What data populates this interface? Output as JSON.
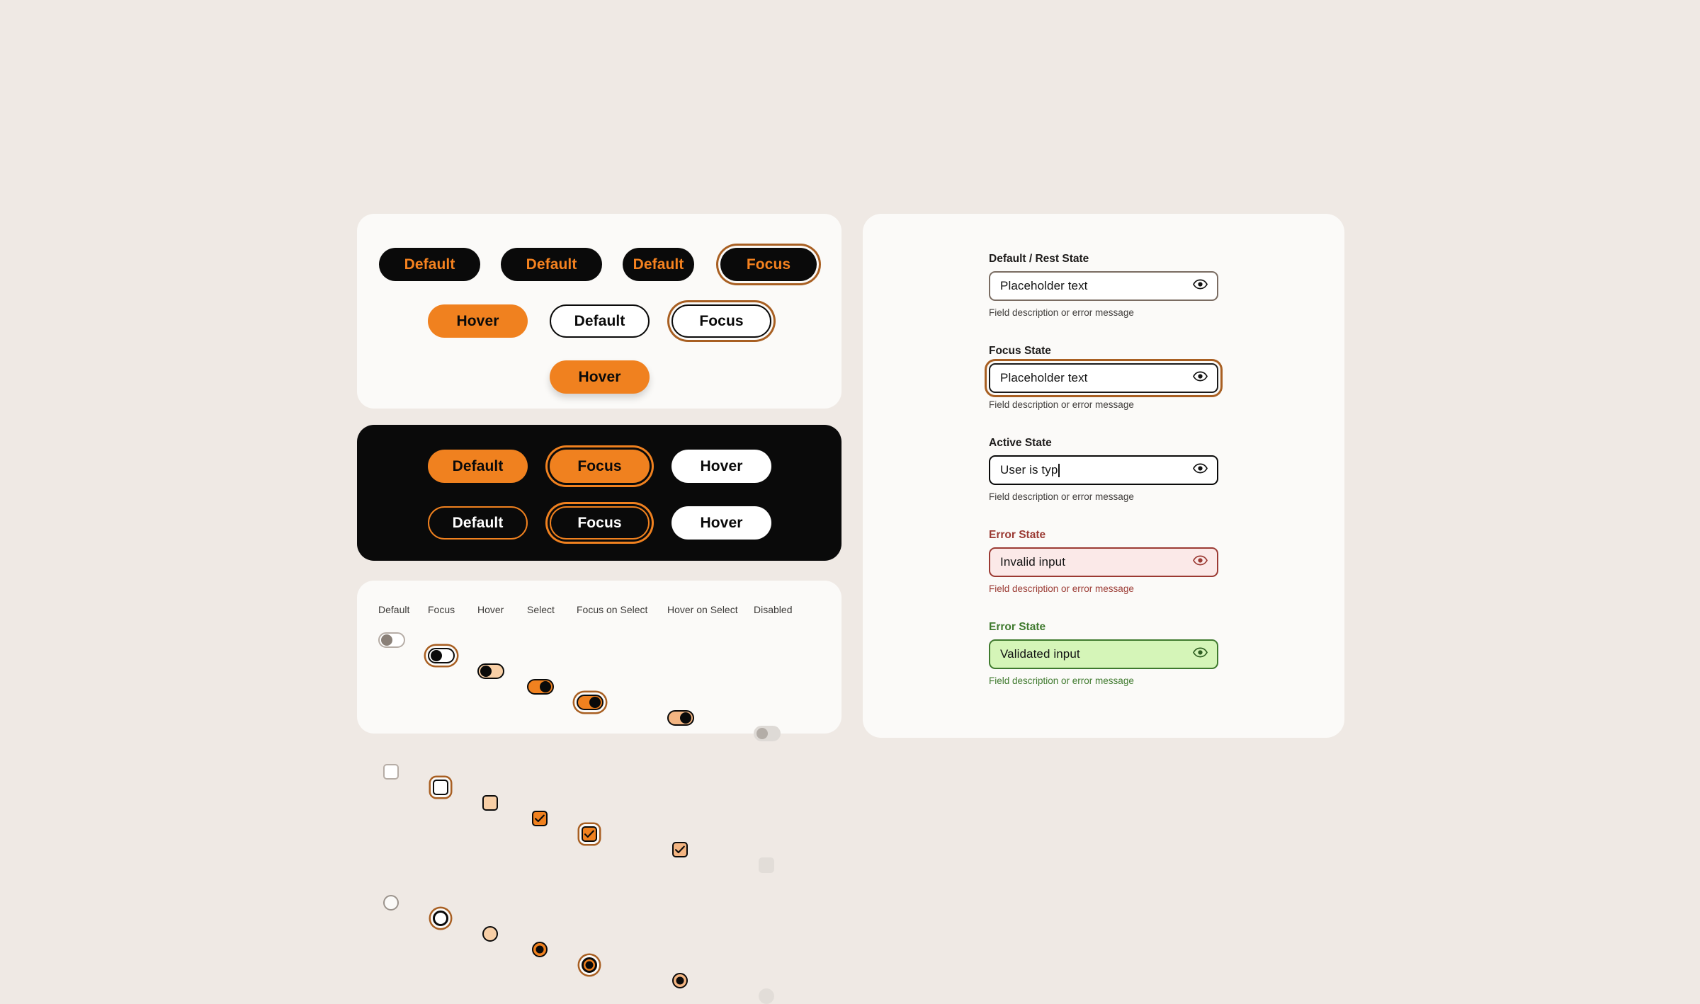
{
  "theme": {
    "page_bg": "#EFE9E4",
    "card_bg": "#FBFAF8",
    "dark_bg": "#0A0A0A",
    "orange": "#F0811F",
    "focus_ring": "#A85F22",
    "focus_ring_dark": "#F0811F",
    "error": "#9B3A33",
    "error_bg": "#FBE9E8",
    "success": "#3F7A2E",
    "success_bg": "#D5F5B8",
    "peach": "#F8CFA6",
    "disabled": "#DCD6D1"
  },
  "buttons_panel": {
    "row1": [
      {
        "label": "Default",
        "style": "dark"
      },
      {
        "label": "Default",
        "style": "dark"
      },
      {
        "label": "Default",
        "style": "dark"
      },
      {
        "label": "Focus",
        "style": "dark-focus"
      }
    ],
    "row2": [
      {
        "label": "Hover",
        "style": "orange"
      },
      {
        "label": "Default",
        "style": "white-outline"
      },
      {
        "label": "Focus",
        "style": "white-outline-focus"
      }
    ],
    "row3": [
      {
        "label": "Hover",
        "style": "orange-shadow"
      }
    ]
  },
  "dark_panel": {
    "row1": [
      {
        "label": "Default",
        "style": "orange"
      },
      {
        "label": "Focus",
        "style": "orange-focus"
      },
      {
        "label": "Hover",
        "style": "white"
      }
    ],
    "row2": [
      {
        "label": "Default",
        "style": "outline-orange"
      },
      {
        "label": "Focus",
        "style": "outline-orange-focus"
      },
      {
        "label": "Hover",
        "style": "white"
      }
    ]
  },
  "controls_panel": {
    "columns": [
      "Default",
      "Focus",
      "Hover",
      "Select",
      "Focus on Select",
      "Hover on Select",
      "Disabled"
    ],
    "rows": [
      {
        "type": "toggle",
        "states": [
          "default",
          "focus",
          "hover",
          "select",
          "focus-on-select",
          "hover-on-select",
          "disabled"
        ]
      },
      {
        "type": "checkbox",
        "states": [
          "default",
          "focus",
          "hover",
          "select",
          "focus-on-select",
          "hover-on-select",
          "disabled"
        ]
      },
      {
        "type": "radio",
        "states": [
          "default",
          "focus",
          "hover",
          "select",
          "focus-on-select",
          "hover-on-select",
          "disabled"
        ]
      }
    ]
  },
  "form_panel": {
    "fields": [
      {
        "label": "Default / Rest State",
        "value": "Placeholder text",
        "placeholder": "Placeholder text",
        "help": "Field description or error message",
        "state": "default",
        "icon": "eye-icon"
      },
      {
        "label": "Focus State",
        "value": "Placeholder text",
        "placeholder": "Placeholder text",
        "help": "Field description or error message",
        "state": "focus",
        "icon": "eye-icon"
      },
      {
        "label": "Active State",
        "value": "User is typ",
        "placeholder": "Placeholder text",
        "help": "Field description or error message",
        "state": "active",
        "icon": "eye-icon"
      },
      {
        "label": "Error State",
        "value": "Invalid input",
        "placeholder": "Placeholder text",
        "help": "Field description or error message",
        "state": "error",
        "icon": "eye-icon"
      },
      {
        "label": "Error State",
        "value": "Validated input",
        "placeholder": "Placeholder text",
        "help": "Field description or error message",
        "state": "success",
        "icon": "eye-icon"
      }
    ]
  }
}
